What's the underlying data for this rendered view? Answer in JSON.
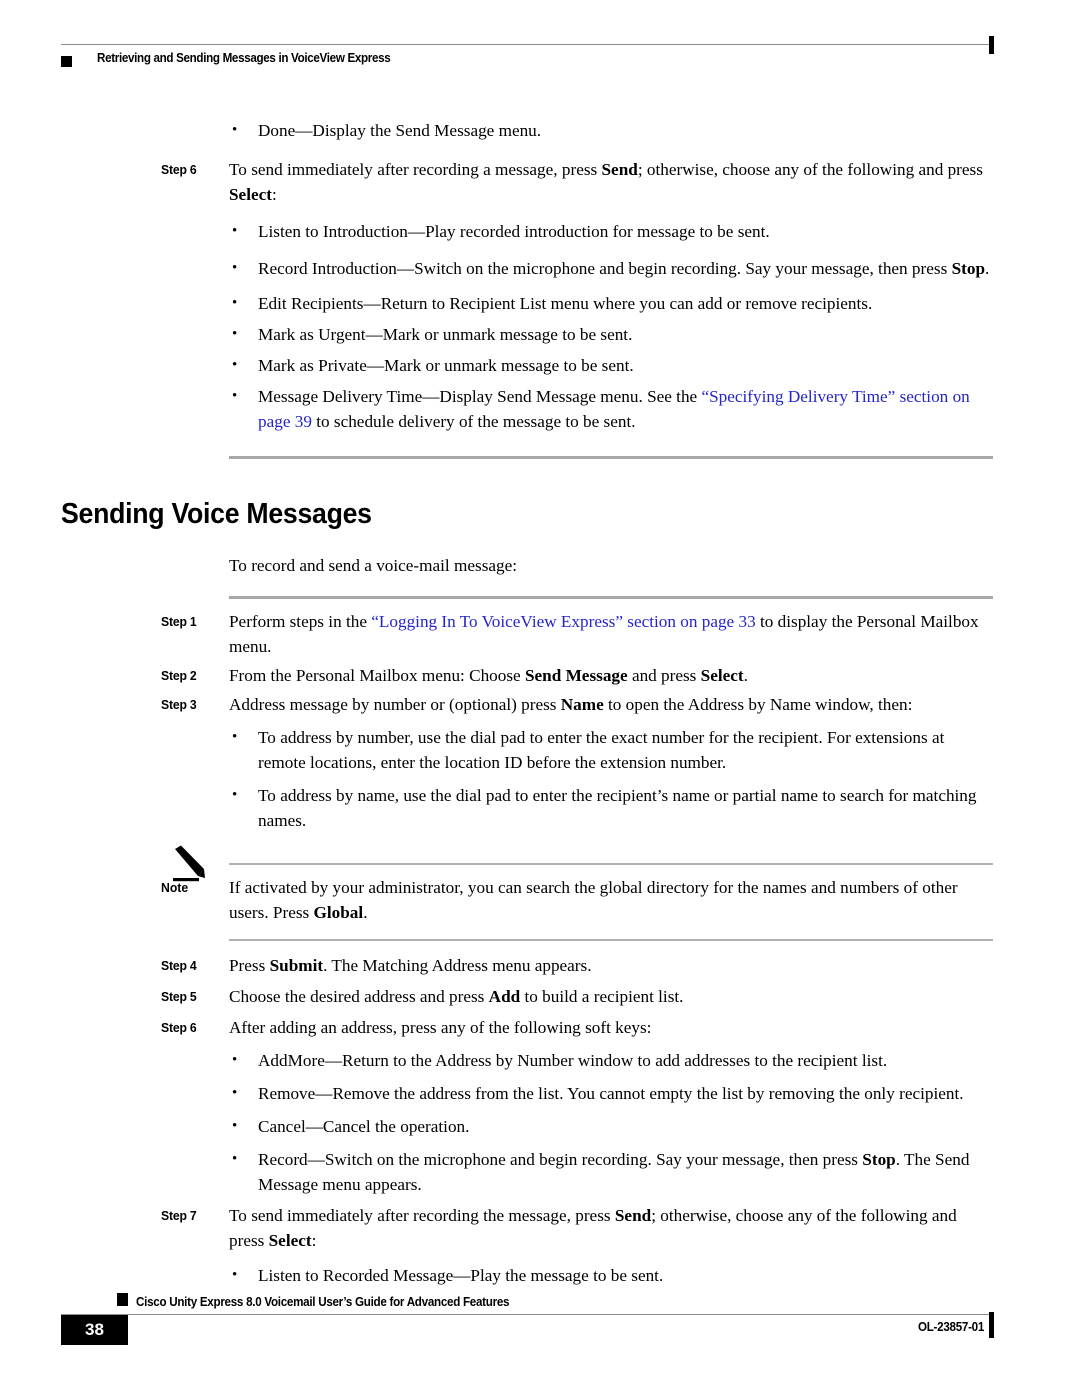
{
  "header": {
    "running_head": "Retrieving and Sending Messages in VoiceView Express"
  },
  "colors": {
    "link": "#2525CC",
    "rule_gray": "#A8A8A8",
    "text": "#000000"
  },
  "top_section": {
    "bullet_done": {
      "term": "Done",
      "dash": "—",
      "desc": "Display the Send Message menu."
    },
    "step6": {
      "label": "Step 6",
      "part1": "To send immediately after recording a message, press ",
      "bold1": "Send",
      "part2": "; otherwise, choose any of the following and press ",
      "bold2": "Select",
      "part3": ":"
    },
    "bullets": [
      {
        "term": "Listen to Introduction",
        "dash": "—",
        "desc": "Play recorded introduction for message to be sent."
      },
      {
        "term": "Record Introduction",
        "dash": "—",
        "desc": "Switch on the microphone and begin recording. Say your message, then press ",
        "bold": "Stop",
        "tail": "."
      },
      {
        "term": "Edit Recipients",
        "dash": "—",
        "desc": "Return to Recipient List menu where you can add or remove recipients."
      },
      {
        "term": "Mark as Urgent",
        "dash": "—",
        "desc": "Mark or unmark message to be sent."
      },
      {
        "term": "Mark as Private",
        "dash": "—",
        "desc": "Mark or unmark message to be sent."
      },
      {
        "term": "Message Delivery Time",
        "dash": "—",
        "desc": "Display Send Message menu. See the ",
        "link": "“Specifying Delivery Time” section on page 39",
        "tail": " to schedule delivery of the message to be sent."
      }
    ]
  },
  "section": {
    "heading": "Sending Voice Messages",
    "intro": "To record and send a voice-mail message:"
  },
  "steps": [
    {
      "label": "Step 1",
      "part1": "Perform steps in the ",
      "link": "“Logging In To VoiceView Express” section on page 33",
      "part2": " to display the Personal Mailbox menu."
    },
    {
      "label": "Step 2",
      "part1": "From the Personal Mailbox menu: Choose ",
      "bold1": "Send Message",
      "part2": " and press ",
      "bold2": "Select",
      "part3": "."
    },
    {
      "label": "Step 3",
      "part1": "Address message by number or (optional) press ",
      "bold1": "Name",
      "part2": " to open the Address by Name window, then:"
    }
  ],
  "step3_bullets": [
    {
      "desc": "To address by number, use the dial pad to enter the exact number for the recipient. For extensions at remote locations, enter the location ID before the extension number."
    },
    {
      "desc": "To address by name, use the dial pad to enter the recipient’s name or partial name to search for matching names."
    }
  ],
  "note": {
    "icon": "pencil-icon",
    "label": "Note",
    "part1": "If activated by your administrator, you can search the global directory for the names and numbers of other users. Press ",
    "bold1": "Global",
    "part2": "."
  },
  "steps2": [
    {
      "label": "Step 4",
      "part1": "Press ",
      "bold1": "Submit",
      "part2": ". The Matching Address menu appears."
    },
    {
      "label": "Step 5",
      "part1": "Choose the desired address and press ",
      "bold1": "Add",
      "part2": " to build a recipient list."
    },
    {
      "label": "Step 6",
      "part1": "After adding an address, press any of the following soft keys:"
    }
  ],
  "step6_bullets": [
    {
      "term": "AddMore",
      "dash": "—",
      "desc": "Return to the Address by Number window to add addresses to the recipient list."
    },
    {
      "term": "Remove",
      "dash": "—",
      "desc": "Remove the address from the list. You cannot empty the list by removing the only recipient."
    },
    {
      "term": "Cancel",
      "dash": "—",
      "desc": "Cancel the operation."
    },
    {
      "term": "Record",
      "dash": "—",
      "desc": "Switch on the microphone and begin recording. Say your message, then press ",
      "bold": "Stop",
      "tail": ". The Send Message menu appears."
    }
  ],
  "step7": {
    "label": "Step 7",
    "part1": "To send immediately after recording the message, press ",
    "bold1": "Send",
    "part2": "; otherwise, choose any of the following and press ",
    "bold2": "Select",
    "part3": ":"
  },
  "step7_bullets": [
    {
      "term": "Listen to Recorded Message",
      "dash": "—",
      "desc": "Play the message to be sent."
    }
  ],
  "footer": {
    "page_number": "38",
    "guide_title": "Cisco Unity Express 8.0 Voicemail User’s Guide for Advanced Features",
    "doc_id": "OL-23857-01"
  },
  "bullet_glyph": "•"
}
